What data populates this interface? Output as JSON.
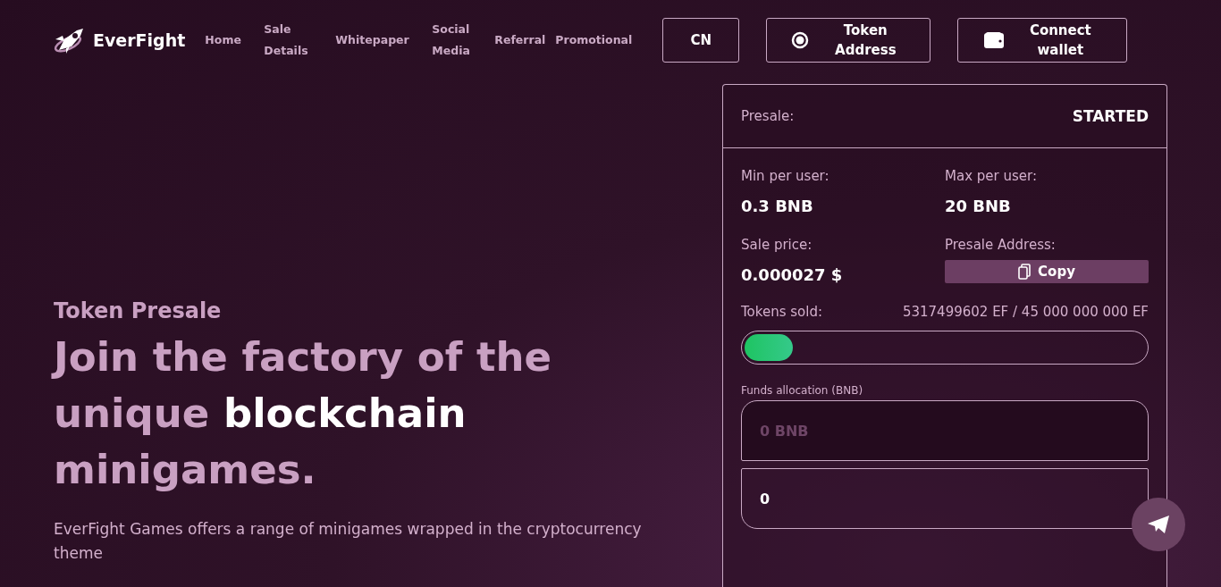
{
  "brand": "EverFight",
  "nav": [
    "Home",
    "Sale Details",
    "Whitepaper",
    "Social Media",
    "Referral",
    "Promotional"
  ],
  "buttons": [
    {
      "kind": "lang",
      "label": "CN"
    },
    {
      "kind": "token",
      "label": "Token Address"
    },
    {
      "kind": "wallet",
      "label": "Connect wallet"
    }
  ],
  "hero": {
    "eyebrow": "Token Presale",
    "headline": "Join the factory of the unique **blockchain** minigames.",
    "description": "EverFight Games offers a range of minigames wrapped in the cryptocurrency theme"
  },
  "presale": {
    "label": "Presale:",
    "status": "STARTED",
    "stats": [
      {
        "label": "Min per user:",
        "value": "0.3 BNB"
      },
      {
        "label": "Max per user:",
        "value": "20 BNB"
      },
      {
        "label": "Sale price:",
        "value": "0.000027 $"
      }
    ],
    "address": {
      "label": "Presale Address:",
      "button": "Copy"
    },
    "tokens_sold": {
      "label": "Tokens sold:",
      "reading": "5317499602 EF / 45 000 000 000 EF",
      "level": 0.12
    },
    "funds": {
      "label": "Funds allocation (BNB)",
      "placeholder": "0 BNB",
      "value": "0"
    }
  }
}
